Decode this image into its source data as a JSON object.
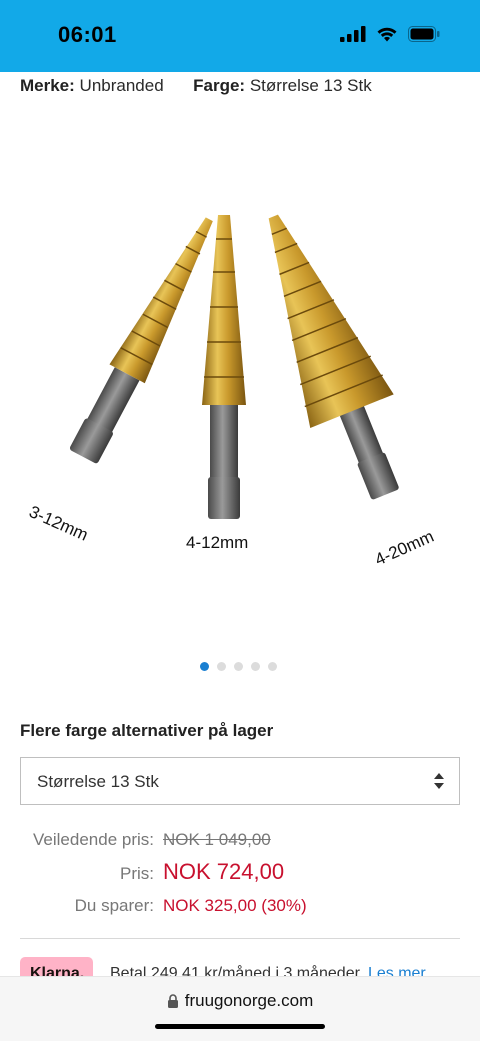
{
  "status_bar": {
    "time": "06:01",
    "icons": [
      "cellular-signal-icon",
      "wifi-icon",
      "battery-icon"
    ],
    "background": "#12a9e8"
  },
  "specs": {
    "brand_label": "Merke:",
    "brand_value": "Unbranded",
    "color_label": "Farge:",
    "color_value": "Størrelse 13 Stk"
  },
  "product_image": {
    "labels": [
      "3-12mm",
      "4-12mm",
      "4-20mm"
    ],
    "carousel_pages": 5,
    "carousel_active_index": 0
  },
  "options": {
    "title": "Flere farge alternativer på lager",
    "selected": "Størrelse 13 Stk"
  },
  "pricing": {
    "rrp_label": "Veiledende pris:",
    "rrp_value": "NOK 1 049,00",
    "price_label": "Pris:",
    "price_value": "NOK 724,00",
    "savings_label": "Du sparer:",
    "savings_value": "NOK 325,00 (30%)",
    "accent_color": "#c8102e"
  },
  "klarna": {
    "badge": "Klarna.",
    "text": "Betal 249,41 kr/måned i 3 måneder.",
    "link": "Les mer"
  },
  "browser": {
    "url": "fruugonorge.com"
  }
}
